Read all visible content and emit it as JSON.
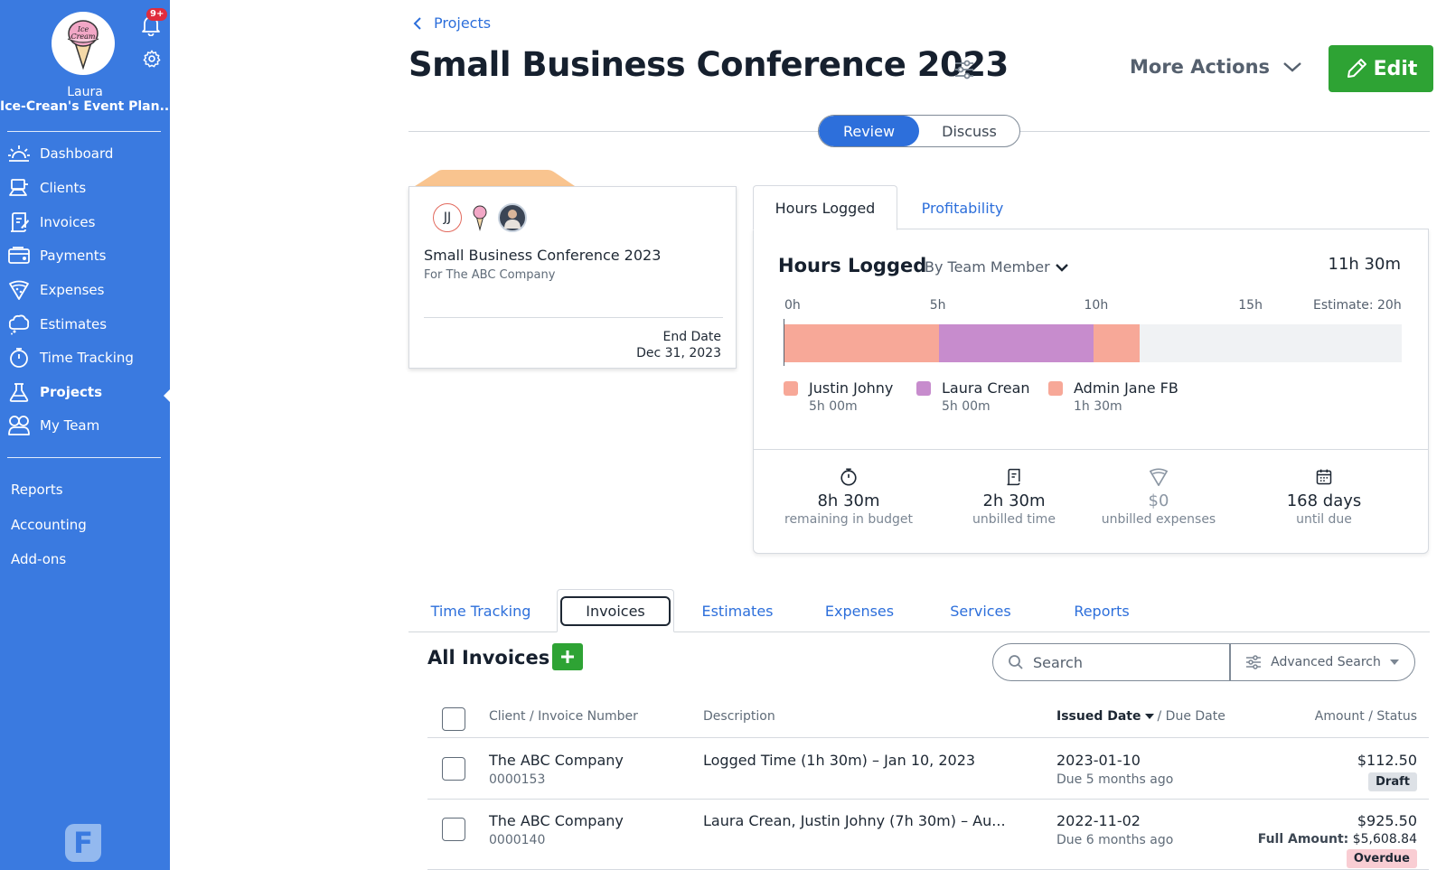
{
  "sidebar": {
    "notification_count": "9+",
    "user_name": "Laura",
    "org_name": "Ice-Crean's Event Plan...",
    "nav": [
      {
        "label": "Dashboard",
        "icon": "dashboard-icon"
      },
      {
        "label": "Clients",
        "icon": "clients-icon"
      },
      {
        "label": "Invoices",
        "icon": "invoices-icon"
      },
      {
        "label": "Payments",
        "icon": "payments-icon"
      },
      {
        "label": "Expenses",
        "icon": "expenses-icon"
      },
      {
        "label": "Estimates",
        "icon": "estimates-icon"
      },
      {
        "label": "Time Tracking",
        "icon": "stopwatch-icon"
      },
      {
        "label": "Projects",
        "icon": "flask-icon"
      },
      {
        "label": "My Team",
        "icon": "team-icon"
      }
    ],
    "active_nav": "Projects",
    "secondary": [
      "Reports",
      "Accounting",
      "Add-ons"
    ],
    "logo_letter": "F"
  },
  "header": {
    "back_label": "Projects",
    "title": "Small Business Conference 2023",
    "more_actions": "More Actions",
    "edit_label": "Edit",
    "toggle": {
      "review": "Review",
      "discuss": "Discuss",
      "selected": "Review"
    }
  },
  "project_card": {
    "initials": "JJ",
    "name": "Small Business Conference 2023",
    "client_line": "For The ABC Company",
    "end_label": "End Date",
    "end_date": "Dec 31, 2023"
  },
  "hours_panel": {
    "tabs": [
      "Hours Logged",
      "Profitability"
    ],
    "title": "Hours Logged",
    "filter": "By Team Member",
    "total": "11h 30m",
    "ticks": [
      "0h",
      "5h",
      "10h",
      "15h",
      "Estimate: 20h"
    ],
    "stats": [
      {
        "icon": "stopwatch-icon",
        "value": "8h 30m",
        "label": "remaining in budget",
        "muted": false
      },
      {
        "icon": "invoice-icon",
        "value": "2h 30m",
        "label": "unbilled time",
        "muted": false
      },
      {
        "icon": "expense-icon",
        "value": "$0",
        "label": "unbilled expenses",
        "muted": true
      },
      {
        "icon": "calendar-icon",
        "value": "168 days",
        "label": "until due",
        "muted": false
      }
    ]
  },
  "chart_data": {
    "type": "bar",
    "orientation": "horizontal-stacked",
    "xlim": [
      0,
      20
    ],
    "unit": "hours",
    "series": [
      {
        "name": "Justin Johny",
        "value": 5.0,
        "label": "5h 00m",
        "color": "#f7a898"
      },
      {
        "name": "Laura Crean",
        "value": 5.0,
        "label": "5h 00m",
        "color": "#c78ccd"
      },
      {
        "name": "Admin Jane FB",
        "value": 1.5,
        "label": "1h 30m",
        "color": "#f7a898"
      }
    ]
  },
  "tabs": {
    "items": [
      "Time Tracking",
      "Invoices",
      "Estimates",
      "Expenses",
      "Services",
      "Reports"
    ],
    "active": "Invoices"
  },
  "invoices": {
    "title": "All Invoices",
    "search_placeholder": "Search",
    "advanced_search": "Advanced Search",
    "columns": {
      "client": "Client / Invoice Number",
      "description": "Description",
      "issued": "Issued Date",
      "due": "/ Due Date",
      "amount": "Amount / Status"
    },
    "rows": [
      {
        "client": "The ABC Company",
        "number": "0000153",
        "description": "Logged Time (1h 30m) – Jan 10, 2023",
        "issued": "2023-01-10",
        "due": "Due 5 months ago",
        "amount": "$112.50",
        "full_amount_label": "",
        "full_amount": "",
        "status": "Draft",
        "status_color": "#dde1e6"
      },
      {
        "client": "The ABC Company",
        "number": "0000140",
        "description": "Laura Crean, Justin Johny (7h 30m) – Au...",
        "issued": "2022-11-02",
        "due": "Due 6 months ago",
        "amount": "$925.50",
        "full_amount_label": "Full Amount:",
        "full_amount": "$5,608.84",
        "status": "Overdue",
        "status_color": "#f9cdd3"
      }
    ]
  },
  "colors": {
    "sidebar": "#3a7ae0",
    "accent": "#2d6fdb",
    "primary_button": "#2ea334",
    "card_tab": "#f9c48f"
  }
}
